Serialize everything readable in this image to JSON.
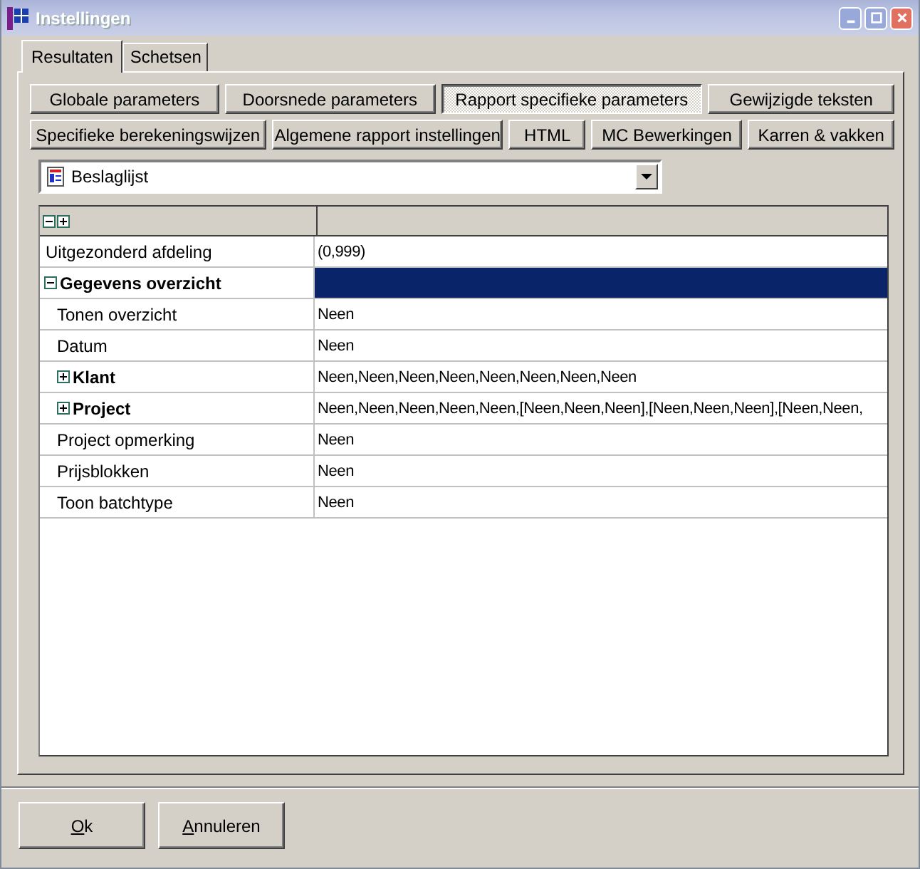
{
  "window": {
    "title": "Instellingen",
    "active": false
  },
  "tabs": [
    {
      "label": "Resultaten",
      "selected": true
    },
    {
      "label": "Schetsen",
      "selected": false
    }
  ],
  "button_rows": [
    [
      {
        "label": "Globale parameters",
        "selected": false
      },
      {
        "label": "Doorsnede parameters",
        "selected": false
      },
      {
        "label": "Rapport specifieke parameters",
        "selected": true
      },
      {
        "label": "Gewijzigde teksten",
        "selected": false
      }
    ],
    [
      {
        "label": "Specifieke berekeningswijzen",
        "selected": false
      },
      {
        "label": "Algemene rapport instellingen",
        "selected": false
      },
      {
        "label": "HTML",
        "selected": false
      },
      {
        "label": "MC Bewerkingen",
        "selected": false
      },
      {
        "label": "Karren & vakken",
        "selected": false
      }
    ]
  ],
  "report_select": {
    "value": "Beslaglijst"
  },
  "property_grid": {
    "rows": [
      {
        "name": "Uitgezonderd afdeling",
        "value": "(0,999)",
        "selected": false
      },
      {
        "name": "Gegevens overzicht",
        "expanded": true,
        "selected": true,
        "children": [
          {
            "name": "Tonen overzicht",
            "value": "Neen",
            "selected": false
          },
          {
            "name": "Datum",
            "value": "Neen",
            "selected": false
          },
          {
            "name": "Klant",
            "value": "Neen,Neen,Neen,Neen,Neen,Neen,Neen,Neen",
            "expanded": false,
            "selected": false
          },
          {
            "name": "Project",
            "value": "Neen,Neen,Neen,Neen,Neen,[Neen,Neen,Neen],[Neen,Neen,Neen],[Neen,Neen,",
            "expanded": false,
            "selected": false
          },
          {
            "name": "Project opmerking",
            "value": "Neen",
            "selected": false
          },
          {
            "name": "Prijsblokken",
            "value": "Neen",
            "selected": false
          },
          {
            "name": "Toon batchtype",
            "value": "Neen",
            "selected": false
          }
        ]
      }
    ]
  },
  "buttons": [
    {
      "label": "Ok",
      "underline_first": true
    },
    {
      "label": "Annuleren",
      "underline_first": true
    }
  ]
}
